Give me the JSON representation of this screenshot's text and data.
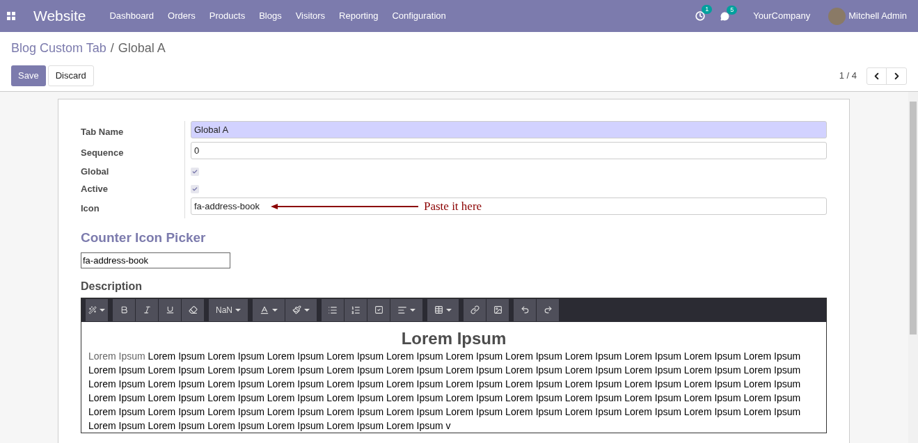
{
  "navbar": {
    "app_name": "Website",
    "menu": [
      "Dashboard",
      "Orders",
      "Products",
      "Blogs",
      "Visitors",
      "Reporting",
      "Configuration"
    ],
    "activity_count": "1",
    "message_count": "5",
    "company": "YourCompany",
    "user": "Mitchell Admin"
  },
  "breadcrumb": {
    "parent": "Blog Custom Tab",
    "separator": "/",
    "current": "Global A"
  },
  "buttons": {
    "save": "Save",
    "discard": "Discard"
  },
  "pager": {
    "value": "1 / 4"
  },
  "form": {
    "fields": [
      {
        "kind": "text",
        "label": "Tab Name",
        "value": "Global A",
        "required": true
      },
      {
        "kind": "text",
        "label": "Sequence",
        "value": "0",
        "required": false
      },
      {
        "kind": "checkbox",
        "label": "Global",
        "checked": true
      },
      {
        "kind": "checkbox",
        "label": "Active",
        "checked": true
      },
      {
        "kind": "text",
        "label": "Icon",
        "value": "fa-address-book",
        "required": false,
        "annotation": "Paste it here"
      }
    ],
    "picker_title": "Counter Icon Picker",
    "picker_value": "fa-address-book",
    "description_label": "Description",
    "toolbar": {
      "font_size": "NaN"
    },
    "content": {
      "heading": "Lorem Ipsum",
      "lead": "Lorem Ipsum",
      "body": "Lorem Ipsum Lorem Ipsum Lorem Ipsum Lorem Ipsum Lorem Ipsum Lorem Ipsum Lorem Ipsum Lorem Ipsum Lorem Ipsum Lorem Ipsum Lorem Ipsum Lorem Ipsum Lorem Ipsum Lorem Ipsum Lorem Ipsum Lorem Ipsum Lorem Ipsum Lorem Ipsum Lorem Ipsum Lorem Ipsum Lorem Ipsum Lorem Ipsum Lorem Ipsum Lorem Ipsum Lorem Ipsum Lorem Ipsum Lorem Ipsum Lorem Ipsum Lorem Ipsum Lorem Ipsum Lorem Ipsum Lorem Ipsum Lorem Ipsum Lorem Ipsum Lorem Ipsum Lorem Ipsum Lorem Ipsum Lorem Ipsum Lorem Ipsum Lorem Ipsum Lorem Ipsum Lorem Ipsum Lorem Ipsum Lorem Ipsum Lorem Ipsum Lorem Ipsum Lorem Ipsum Lorem Ipsum Lorem Ipsum Lorem Ipsum Lorem Ipsum Lorem Ipsum Lorem Ipsum Lorem Ipsum Lorem Ipsum Lorem Ipsum Lorem Ipsum Lorem Ipsum Lorem Ipsum Lorem Ipsum Lorem Ipsum Lorem Ipsum Lorem Ipsum Lorem Ipsum Lorem Ipsum v"
    }
  }
}
